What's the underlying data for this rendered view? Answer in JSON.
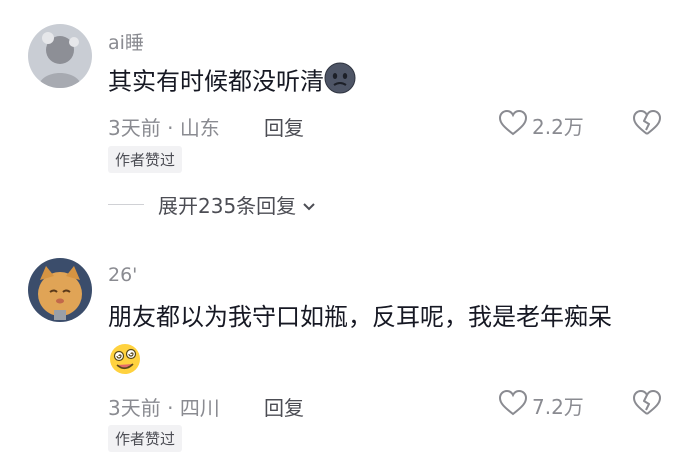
{
  "comments": [
    {
      "username": "ai睡",
      "text": "其实有时候都没听清",
      "emoji_icon": "sad-face-emoji",
      "time": "3天前",
      "location": "山东",
      "meta_sep": "·",
      "reply_label": "回复",
      "likes": "2.2万",
      "badge": "作者赞过"
    },
    {
      "username": "26'",
      "text": "朋友都以为我守口如瓶，反耳呢，我是老年痴呆",
      "emoji_icon": "dizzy-face-emoji",
      "time": "3天前",
      "location": "四川",
      "meta_sep": "·",
      "reply_label": "回复",
      "likes": "7.2万",
      "badge": "作者赞过"
    }
  ],
  "expand_replies": {
    "label": "展开235条回复"
  },
  "colors": {
    "text": "#161823",
    "muted": "#8a8b91",
    "badge_bg": "#f2f2f4"
  }
}
